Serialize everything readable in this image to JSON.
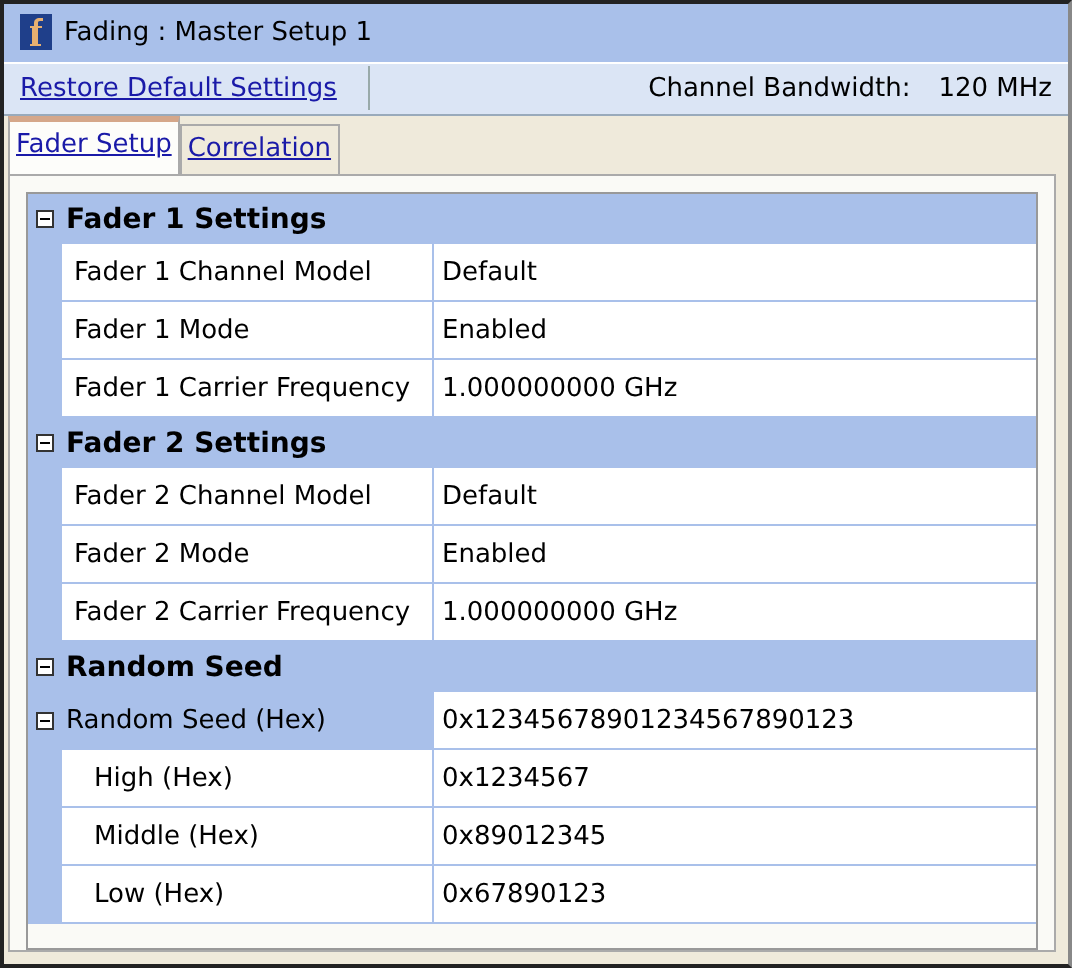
{
  "window": {
    "title": "Fading : Master Setup 1"
  },
  "toolbar": {
    "link": "Restore Default Settings",
    "bandwidth_label": "Channel Bandwidth:",
    "bandwidth_value": "120 MHz"
  },
  "tabs": [
    {
      "label": "Fader Setup",
      "selected": true
    },
    {
      "label": "Correlation",
      "selected": false
    }
  ],
  "groups": [
    {
      "title": "Fader 1 Settings",
      "expanded": true,
      "rows": [
        {
          "label": "Fader 1 Channel Model",
          "value": "Default"
        },
        {
          "label": "Fader 1 Mode",
          "value": "Enabled"
        },
        {
          "label": "Fader 1 Carrier Frequency",
          "value": "1.000000000 GHz"
        }
      ]
    },
    {
      "title": "Fader 2 Settings",
      "expanded": true,
      "rows": [
        {
          "label": "Fader 2 Channel Model",
          "value": "Default"
        },
        {
          "label": "Fader 2 Mode",
          "value": "Enabled"
        },
        {
          "label": "Fader 2 Carrier Frequency",
          "value": "1.000000000 GHz"
        }
      ]
    },
    {
      "title": "Random Seed",
      "expanded": true,
      "rows": [
        {
          "label": "Random Seed (Hex)",
          "value": "0x12345678901234567890123",
          "expanded": true,
          "children": [
            {
              "label": "High (Hex)",
              "value": "0x1234567"
            },
            {
              "label": "Middle (Hex)",
              "value": "0x89012345"
            },
            {
              "label": "Low (Hex)",
              "value": "0x67890123"
            }
          ]
        }
      ]
    }
  ]
}
